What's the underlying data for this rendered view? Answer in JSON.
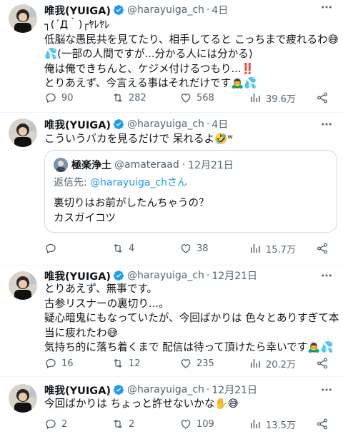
{
  "colors": {
    "text": "#0f1419",
    "secondary": "#536471",
    "link": "#1d9bf0",
    "verified": "#1d9bf0",
    "border": "#eff3f4"
  },
  "tweets": [
    {
      "name": "唯我(YUIGA)",
      "handle": "@harayuiga_ch",
      "time": "4日",
      "lines": [
        "┐(´Д｀)┌ﾔﾚﾔﾚ",
        "低脳な愚民共を見てたり、相手してると こっちまで疲れるわ😅",
        "💦(一部の人間ですが...分かる人には分かる)",
        "俺は俺できちんと、ケジメ付けるつもり...‼️",
        "とりあえず、今言える事はそれだけです🙇‍♂️💦"
      ],
      "replies": "90",
      "retweets": "282",
      "likes": "568",
      "views": "39.6万"
    },
    {
      "name": "唯我(YUIGA)",
      "handle": "@harayuiga_ch",
      "time": "4日",
      "lines": [
        "こういうバカを見るだけで 呆れるよ🤣ʷ"
      ],
      "quote": {
        "name": "極楽浄土",
        "handle": "@amateraad",
        "time": "12月21日",
        "reply_prefix": "返信先: ",
        "reply_to": "@harayuiga_chさん",
        "lines": [
          "裏切りはお前がしたんちゃうの？",
          "カスガイコツ"
        ]
      },
      "replies": "",
      "retweets": "4",
      "likes": "38",
      "views": "15.7万"
    },
    {
      "name": "唯我(YUIGA)",
      "handle": "@harayuiga_ch",
      "time": "12月21日",
      "lines": [
        "とりあえず、無事です。",
        "古参リスナーの裏切り...。",
        "疑心暗鬼にもなっていたが、今回ばかりは 色々とありすぎて本",
        "当に疲れたわ😅",
        "気持ち的に落ち着くまで 配信は待って頂けたら幸いです🙇‍♂️💦"
      ],
      "replies": "16",
      "retweets": "12",
      "likes": "235",
      "views": "20.2万"
    },
    {
      "name": "唯我(YUIGA)",
      "handle": "@harayuiga_ch",
      "time": "12月21日",
      "lines": [
        "今回ばかりは ちょっと許せないかな✋😅"
      ],
      "replies": "2",
      "retweets": "2",
      "likes": "109",
      "views": "13.5万"
    }
  ]
}
